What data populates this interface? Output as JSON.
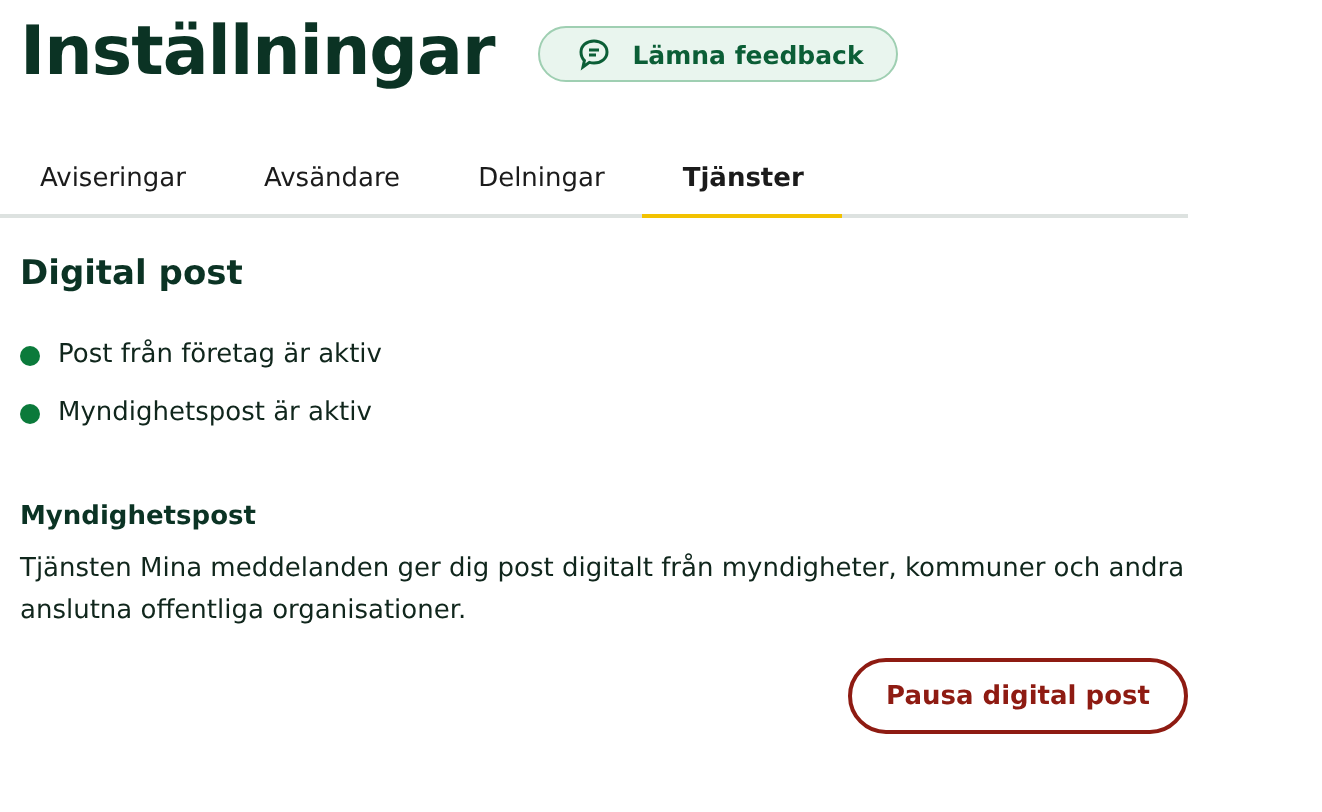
{
  "page_title": "Inställningar",
  "feedback_button": {
    "label": "Lämna feedback"
  },
  "tabs": [
    {
      "label": "Aviseringar",
      "selected": false
    },
    {
      "label": "Avsändare",
      "selected": false
    },
    {
      "label": "Delningar",
      "selected": false
    },
    {
      "label": "Tjänster",
      "selected": true
    }
  ],
  "section": {
    "heading": "Digital post",
    "statuses": [
      {
        "label": "Post från företag är aktiv",
        "active": true
      },
      {
        "label": "Myndighetspost är aktiv",
        "active": true
      }
    ],
    "subheading": "Myndighetspost",
    "description": "Tjänsten Mina meddelanden ger dig post digitalt från myndigheter, kommuner och andra anslutna offentliga organisationer.",
    "action_button": {
      "label": "Pausa digital post"
    }
  }
}
